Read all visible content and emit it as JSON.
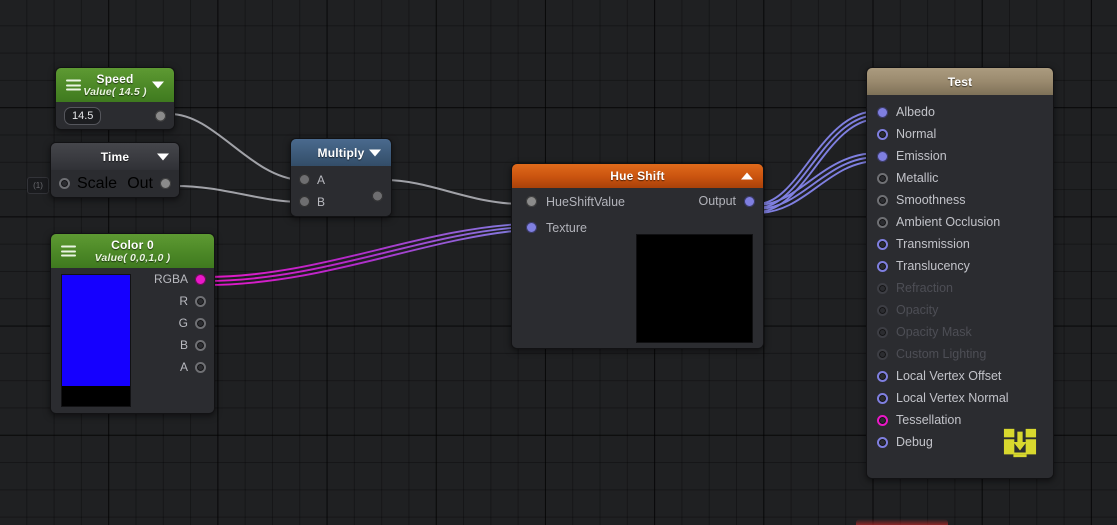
{
  "app": {
    "kind": "shader-graph-node-editor"
  },
  "canvas": {
    "collapsed_chip_label": "(1)"
  },
  "colors": {
    "grid_bg": "#1f2022",
    "node_body": "#2b2c30",
    "header_green": "#4e8a28",
    "header_grey": "#3a3b40",
    "header_blue": "#3d5a79",
    "header_orange": "#c9530f",
    "header_tan": "#9a8a6e",
    "port_grey": "#8b8b8b",
    "port_purple": "#7f7fe0",
    "port_magenta": "#ea18c8",
    "wire_grey": "#b9bac0",
    "wire_magenta": "#c417b4",
    "wire_purple": "#7f7fe0",
    "swatch_color": "#1500ff",
    "download_icon": "#d8d82e"
  },
  "nodes": {
    "speed": {
      "title": "Speed",
      "subtitle": "Value( 14.5 )",
      "value": "14.5",
      "output_port": ""
    },
    "time": {
      "title": "Time",
      "input_label": "Scale",
      "output_label": "Out"
    },
    "color0": {
      "title": "Color 0",
      "subtitle": "Value( 0,0,1,0 )",
      "outputs": [
        {
          "label": "RGBA",
          "port": "magenta-filled"
        },
        {
          "label": "R",
          "port": "grey-hollow"
        },
        {
          "label": "G",
          "port": "grey-hollow"
        },
        {
          "label": "B",
          "port": "grey-hollow"
        },
        {
          "label": "A",
          "port": "grey-hollow"
        }
      ]
    },
    "multiply": {
      "title": "Multiply",
      "inputs": [
        {
          "label": "A"
        },
        {
          "label": "B"
        }
      ],
      "output_label": ""
    },
    "hue_shift": {
      "title": "Hue Shift",
      "inputs": [
        {
          "label": "HueShiftValue",
          "port": "grey-filled"
        },
        {
          "label": "Texture",
          "port": "purple-filled"
        }
      ],
      "output_label": "Output"
    },
    "test": {
      "title": "Test",
      "ports": [
        {
          "label": "Albedo",
          "port": "purple-filled",
          "dim": false
        },
        {
          "label": "Normal",
          "port": "purple-hollow",
          "dim": false
        },
        {
          "label": "Emission",
          "port": "purple-filled",
          "dim": false
        },
        {
          "label": "Metallic",
          "port": "grey-hollow",
          "dim": false
        },
        {
          "label": "Smoothness",
          "port": "grey-hollow",
          "dim": false
        },
        {
          "label": "Ambient Occlusion",
          "port": "grey-hollow",
          "dim": false
        },
        {
          "label": "Transmission",
          "port": "purple-hollow",
          "dim": false
        },
        {
          "label": "Translucency",
          "port": "purple-hollow",
          "dim": false
        },
        {
          "label": "Refraction",
          "port": "dim-hollow",
          "dim": true
        },
        {
          "label": "Opacity",
          "port": "dim-hollow",
          "dim": true
        },
        {
          "label": "Opacity Mask",
          "port": "dim-hollow",
          "dim": true
        },
        {
          "label": "Custom Lighting",
          "port": "dim-hollow",
          "dim": true
        },
        {
          "label": "Local Vertex Offset",
          "port": "purple-hollow",
          "dim": false
        },
        {
          "label": "Local Vertex Normal",
          "port": "purple-hollow",
          "dim": false
        },
        {
          "label": "Tessellation",
          "port": "magenta-hollow",
          "dim": false
        },
        {
          "label": "Debug",
          "port": "purple-hollow",
          "dim": false
        }
      ],
      "save_icon": "download-icon"
    }
  },
  "connections": [
    {
      "from": "speed.output",
      "to": "multiply.A",
      "style": "grey"
    },
    {
      "from": "time.Out",
      "to": "multiply.B",
      "style": "grey"
    },
    {
      "from": "multiply.output",
      "to": "hue_shift.HueShiftValue",
      "style": "grey"
    },
    {
      "from": "color0.RGBA",
      "to": "hue_shift.Texture",
      "style": "magenta-to-purple"
    },
    {
      "from": "hue_shift.Output",
      "to": "test.Albedo",
      "style": "purple"
    },
    {
      "from": "hue_shift.Output",
      "to": "test.Emission",
      "style": "purple"
    }
  ]
}
